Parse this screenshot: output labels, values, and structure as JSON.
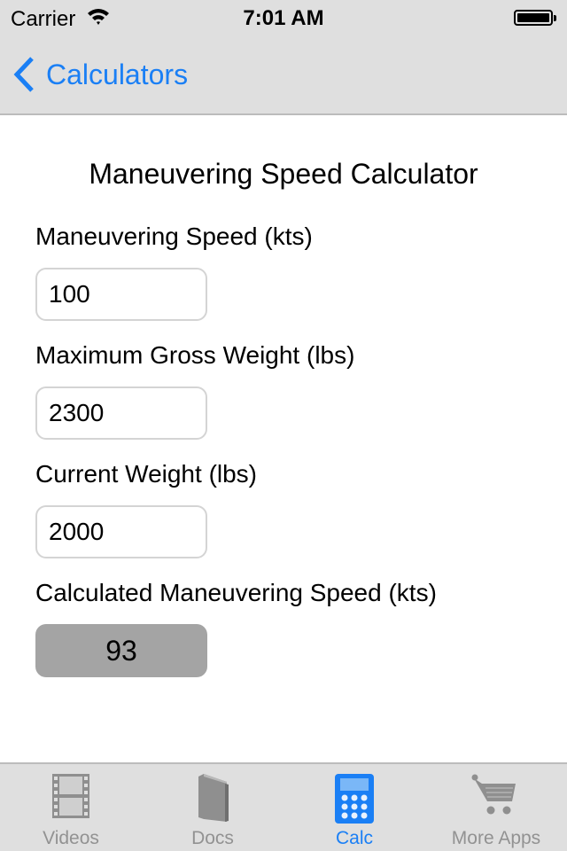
{
  "status_bar": {
    "carrier": "Carrier",
    "time": "7:01 AM",
    "battery_level_percent": 100
  },
  "nav": {
    "back_label": "Calculators"
  },
  "page": {
    "title": "Maneuvering Speed Calculator",
    "fields": [
      {
        "label": "Maneuvering Speed (kts)",
        "value": "100"
      },
      {
        "label": "Maximum Gross Weight (lbs)",
        "value": "2300"
      },
      {
        "label": "Current Weight (lbs)",
        "value": "2000"
      }
    ],
    "result": {
      "label": "Calculated Maneuvering Speed (kts)",
      "value": "93"
    }
  },
  "tabbar": {
    "tabs": [
      {
        "label": "Videos",
        "icon": "film-icon",
        "active": false
      },
      {
        "label": "Docs",
        "icon": "book-icon",
        "active": false
      },
      {
        "label": "Calc",
        "icon": "calculator-icon",
        "active": true
      },
      {
        "label": "More Apps",
        "icon": "cart-icon",
        "active": false
      }
    ]
  },
  "colors": {
    "accent": "#1a7ff5",
    "inactive": "#929292",
    "bar_background": "#dfdfdf",
    "result_background": "#a4a4a4"
  }
}
